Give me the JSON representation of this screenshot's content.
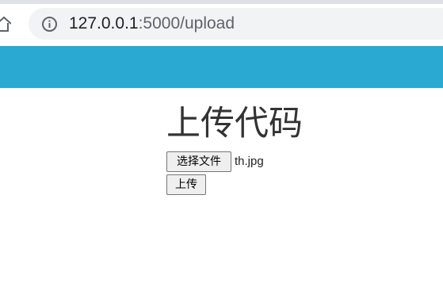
{
  "browser": {
    "url_host": "127.0.0.1",
    "url_rest": ":5000/upload",
    "icons": {
      "home": "home-icon",
      "info": "info-icon"
    }
  },
  "navbar": {
    "color": "#2aa9d2"
  },
  "main": {
    "title": "上传代码",
    "file_button_label": "选择文件",
    "selected_file": "th.jpg",
    "submit_label": "上传"
  }
}
